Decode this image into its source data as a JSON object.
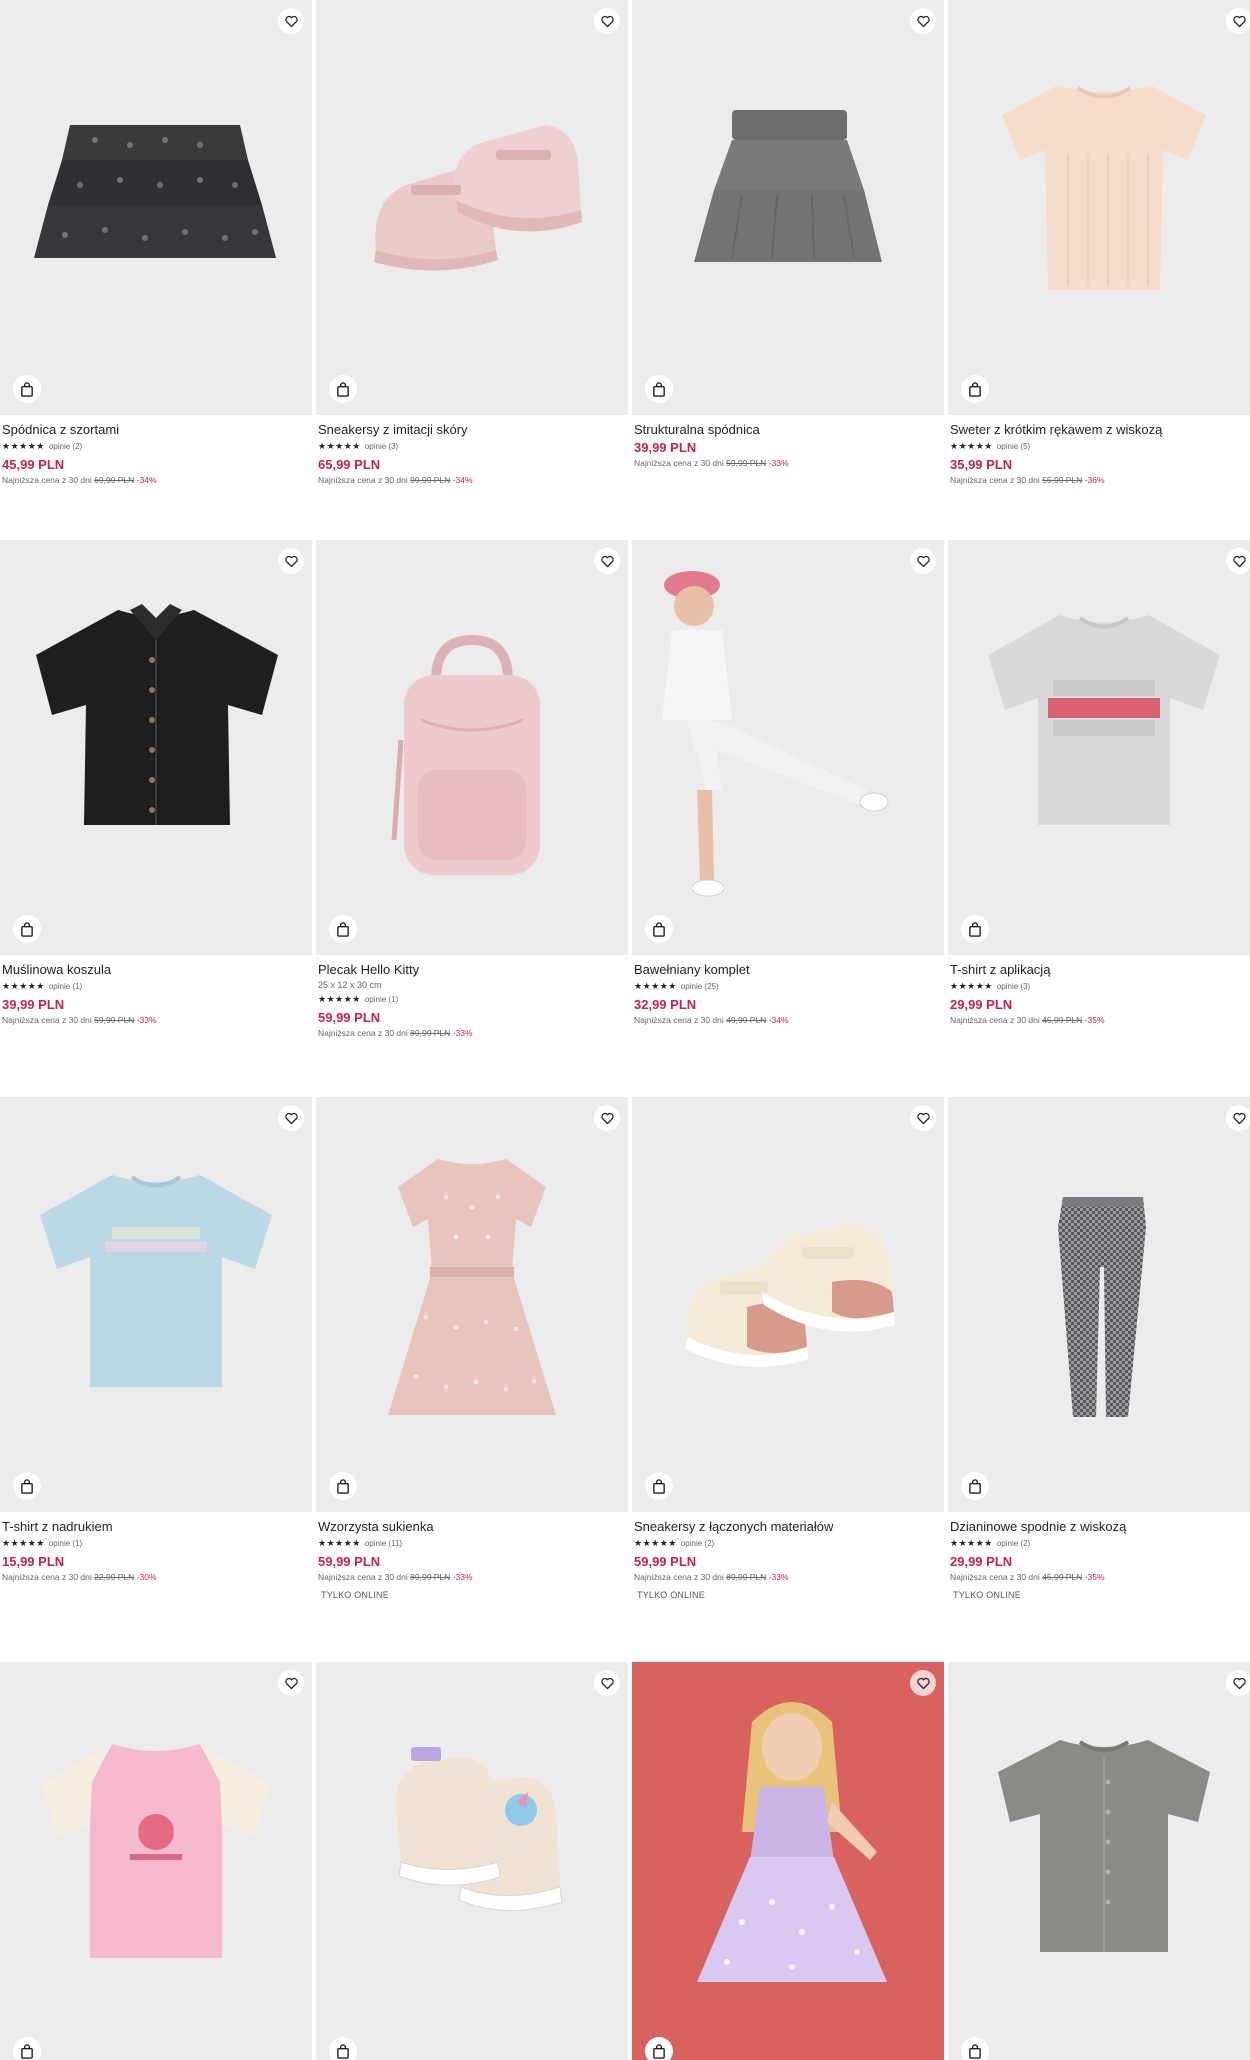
{
  "icons": {
    "favorite": "heart-outline-icon",
    "add_to_cart": "shopping-bag-icon",
    "rating": "star-icon"
  },
  "colors": {
    "price": "#c2244d",
    "image_bg": "#ececec",
    "accent_bg": "#d9625e"
  },
  "products": [
    {
      "name": "Spódnica z szortami",
      "stars": "★★★★★",
      "reviews": "opinie (2)",
      "price": "45,99 PLN",
      "lowest_label": "Najniższa cena z 30 dni",
      "old_price": "69,99 PLN",
      "discount": "-34%"
    },
    {
      "name": "Sneakersy z imitacji skóry",
      "stars": "★★★★★",
      "reviews": "opinie (3)",
      "price": "65,99 PLN",
      "lowest_label": "Najniższa cena z 30 dni",
      "old_price": "99,99 PLN",
      "discount": "-34%"
    },
    {
      "name": "Strukturalna spódnica",
      "price": "39,99 PLN",
      "lowest_label": "Najniższa cena z 30 dni",
      "old_price": "59,99 PLN",
      "discount": "-33%"
    },
    {
      "name": "Sweter z krótkim rękawem z wiskozą",
      "stars": "★★★★★",
      "reviews": "opinie (5)",
      "price": "35,99 PLN",
      "lowest_label": "Najniższa cena z 30 dni",
      "old_price": "55,99 PLN",
      "discount": "-36%"
    },
    {
      "name": "Muślinowa koszula",
      "stars": "★★★★★",
      "reviews": "opinie (1)",
      "price": "39,99 PLN",
      "lowest_label": "Najniższa cena z 30 dni",
      "old_price": "59,99 PLN",
      "discount": "-33%"
    },
    {
      "name": "Plecak Hello Kitty",
      "dims": "25 x 12 x 30 cm",
      "stars": "★★★★★",
      "reviews": "opinie (1)",
      "price": "59,99 PLN",
      "lowest_label": "Najniższa cena z 30 dni",
      "old_price": "89,99 PLN",
      "discount": "-33%"
    },
    {
      "name": "Bawełniany komplet",
      "stars": "★★★★★",
      "reviews": "opinie (25)",
      "price": "32,99 PLN",
      "lowest_label": "Najniższa cena z 30 dni",
      "old_price": "49,99 PLN",
      "discount": "-34%"
    },
    {
      "name": "T-shirt z aplikacją",
      "stars": "★★★★★",
      "reviews": "opinie (3)",
      "price": "29,99 PLN",
      "lowest_label": "Najniższa cena z 30 dni",
      "old_price": "45,99 PLN",
      "discount": "-35%"
    },
    {
      "name": "T-shirt z nadrukiem",
      "stars": "★★★★★",
      "reviews": "opinie (1)",
      "price": "15,99 PLN",
      "lowest_label": "Najniższa cena z 30 dni",
      "old_price": "22,99 PLN",
      "discount": "-30%"
    },
    {
      "name": "Wzorzysta sukienka",
      "stars": "★★★★★",
      "reviews": "opinie (11)",
      "price": "59,99 PLN",
      "lowest_label": "Najniższa cena z 30 dni",
      "old_price": "89,99 PLN",
      "discount": "-33%",
      "badge": "TYLKO ONLINE"
    },
    {
      "name": "Sneakersy z łączonych materiałów",
      "stars": "★★★★★",
      "reviews": "opinie (2)",
      "price": "59,99 PLN",
      "lowest_label": "Najniższa cena z 30 dni",
      "old_price": "89,99 PLN",
      "discount": "-33%",
      "badge": "TYLKO ONLINE"
    },
    {
      "name": "Dzianinowe spodnie z wiskozą",
      "stars": "★★★★★",
      "reviews": "opinie (2)",
      "price": "29,99 PLN",
      "lowest_label": "Najniższa cena z 30 dni",
      "old_price": "45,99 PLN",
      "discount": "-35%",
      "badge": "TYLKO ONLINE"
    }
  ]
}
